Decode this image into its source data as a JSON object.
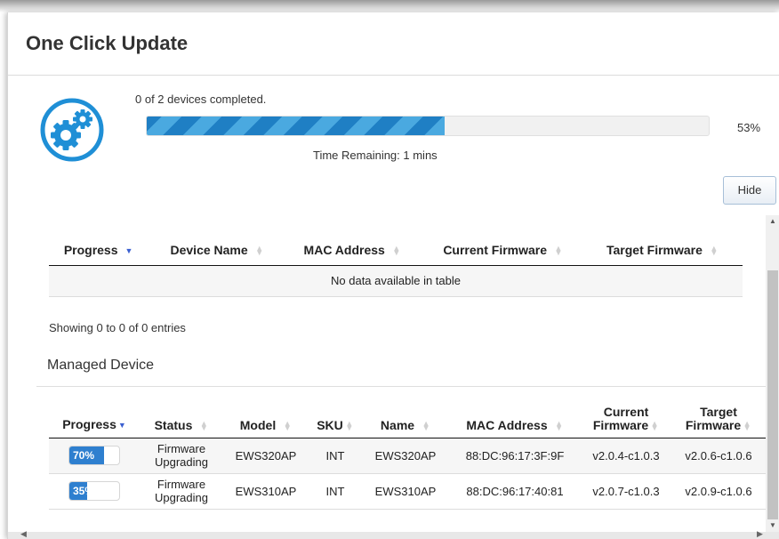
{
  "dialog": {
    "title": "One Click Update",
    "icon": "gears-icon",
    "accent_color": "#1f8fd6"
  },
  "overall_progress": {
    "status_text": "0 of 2 devices completed.",
    "percent_label": "53%",
    "percent_value": 53,
    "time_remaining": "Time Remaining: 1 mins"
  },
  "hide_button": {
    "label": "Hide"
  },
  "update_table": {
    "columns": [
      "Progress",
      "Device Name",
      "MAC Address",
      "Current Firmware",
      "Target Firmware"
    ],
    "empty_message": "No data available in table",
    "info": "Showing 0 to 0 of 0 entries"
  },
  "managed": {
    "heading": "Managed Device",
    "columns": {
      "progress": "Progress",
      "status": "Status",
      "model": "Model",
      "sku": "SKU",
      "name": "Name",
      "mac": "MAC Address",
      "current_fw": "Current Firmware",
      "target_fw": "Target Firmware"
    },
    "rows": [
      {
        "progress_label": "70%",
        "progress_value": 70,
        "status": "Firmware Upgrading",
        "model": "EWS320AP",
        "sku": "INT",
        "name": "EWS320AP",
        "mac": "88:DC:96:17:3F:9F",
        "current_fw": "v2.0.4-c1.0.3",
        "target_fw": "v2.0.6-c1.0.6"
      },
      {
        "progress_label": "35%",
        "progress_value": 35,
        "status": "Firmware Upgrading",
        "model": "EWS310AP",
        "sku": "INT",
        "name": "EWS310AP",
        "mac": "88:DC:96:17:40:81",
        "current_fw": "v2.0.7-c1.0.3",
        "target_fw": "v2.0.9-c1.0.6"
      }
    ]
  }
}
